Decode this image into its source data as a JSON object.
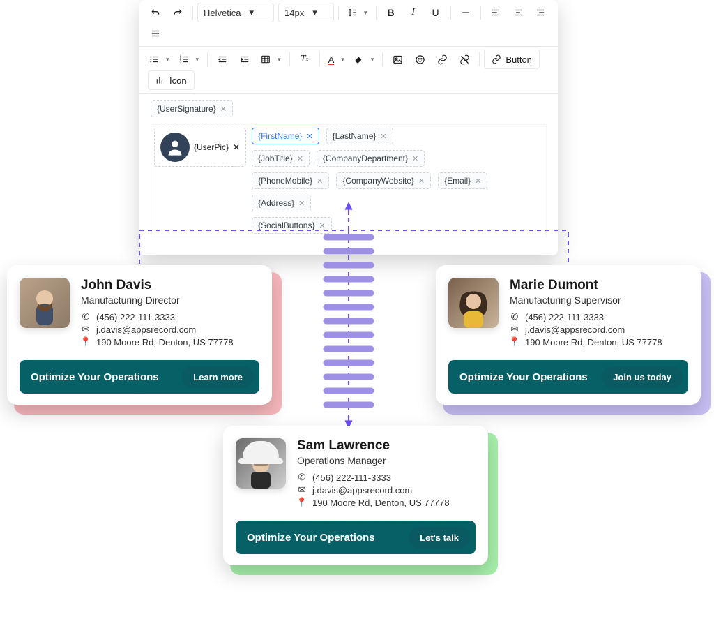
{
  "toolbar": {
    "font": "Helvetica",
    "size": "14px",
    "button_label": "Button",
    "icon_label": "Icon"
  },
  "template": {
    "user_signature": "{UserSignature}",
    "user_pic": "{UserPic}",
    "first_name": "{FirstName}",
    "last_name": "{LastName}",
    "job_title": "{JobTitle}",
    "company_department": "{CompanyDepartment}",
    "phone_mobile": "{PhoneMobile}",
    "company_website": "{CompanyWebsite}",
    "email": "{Email}",
    "address": "{Address}",
    "social_buttons": "{SocialButtons}"
  },
  "cards": {
    "left": {
      "name": "John Davis",
      "title": "Manufacturing Director",
      "phone": "(456) 222-111-3333",
      "email": "j.davis@appsrecord.com",
      "address": "190 Moore Rd, Denton, US 77778",
      "cta_text": "Optimize Your Operations",
      "cta_button": "Learn more"
    },
    "right": {
      "name": "Marie Dumont",
      "title": "Manufacturing Supervisor",
      "phone": "(456) 222-111-3333",
      "email": "j.davis@appsrecord.com",
      "address": "190 Moore Rd, Denton, US 77778",
      "cta_text": "Optimize Your Operations",
      "cta_button": "Join us today"
    },
    "center": {
      "name": "Sam Lawrence",
      "title": "Operations Manager",
      "phone": "(456) 222-111-3333",
      "email": "j.davis@appsrecord.com",
      "address": "190 Moore Rd, Denton, US 77778",
      "cta_text": "Optimize Your Operations",
      "cta_button": "Let's talk"
    }
  }
}
